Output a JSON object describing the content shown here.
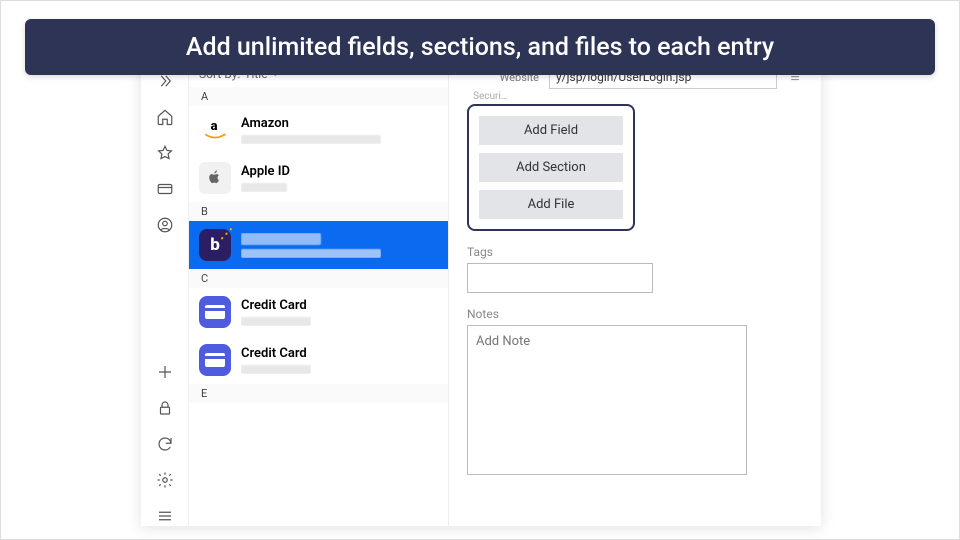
{
  "banner": "Add unlimited fields, sections, and files to each entry",
  "sort": {
    "label": "Sort By:",
    "value": "Title"
  },
  "alpha": {
    "a": "A",
    "b": "B",
    "c": "C",
    "e": "E"
  },
  "items": {
    "amazon": {
      "title": "Amazon"
    },
    "apple": {
      "title": "Apple ID"
    },
    "credit1": {
      "title": "Credit Card"
    },
    "credit2": {
      "title": "Credit Card"
    }
  },
  "detail": {
    "website_label": "Website",
    "website_value": "y/jsp/login/UserLogin.jsp",
    "add_field": "Add Field",
    "add_section": "Add Section",
    "add_file": "Add File",
    "tags_label": "Tags",
    "notes_label": "Notes",
    "notes_placeholder": "Add Note"
  }
}
